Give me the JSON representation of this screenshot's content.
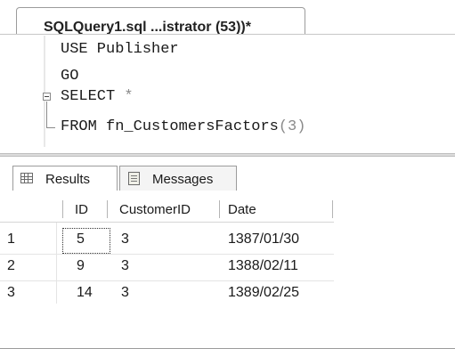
{
  "editor": {
    "tab_title": "SQLQuery1.sql ...istrator (53))*",
    "lines": [
      {
        "text": "USE Publisher"
      },
      {
        "text": "GO"
      },
      {
        "keyword": "SELECT",
        "rest": " *"
      },
      {
        "keyword": "FROM",
        "func": " fn_CustomersFactors",
        "args": "(3)"
      }
    ]
  },
  "results": {
    "tabs": [
      {
        "label": "Results",
        "icon": "grid-icon",
        "active": true
      },
      {
        "label": "Messages",
        "icon": "messages-icon",
        "active": false
      }
    ],
    "columns": [
      "ID",
      "CustomerID",
      "Date"
    ],
    "rows": [
      {
        "num": "1",
        "cells": [
          "5",
          "3",
          "1387/01/30"
        ]
      },
      {
        "num": "2",
        "cells": [
          "9",
          "3",
          "1388/02/11"
        ]
      },
      {
        "num": "3",
        "cells": [
          "14",
          "3",
          "1389/02/25"
        ]
      }
    ]
  }
}
